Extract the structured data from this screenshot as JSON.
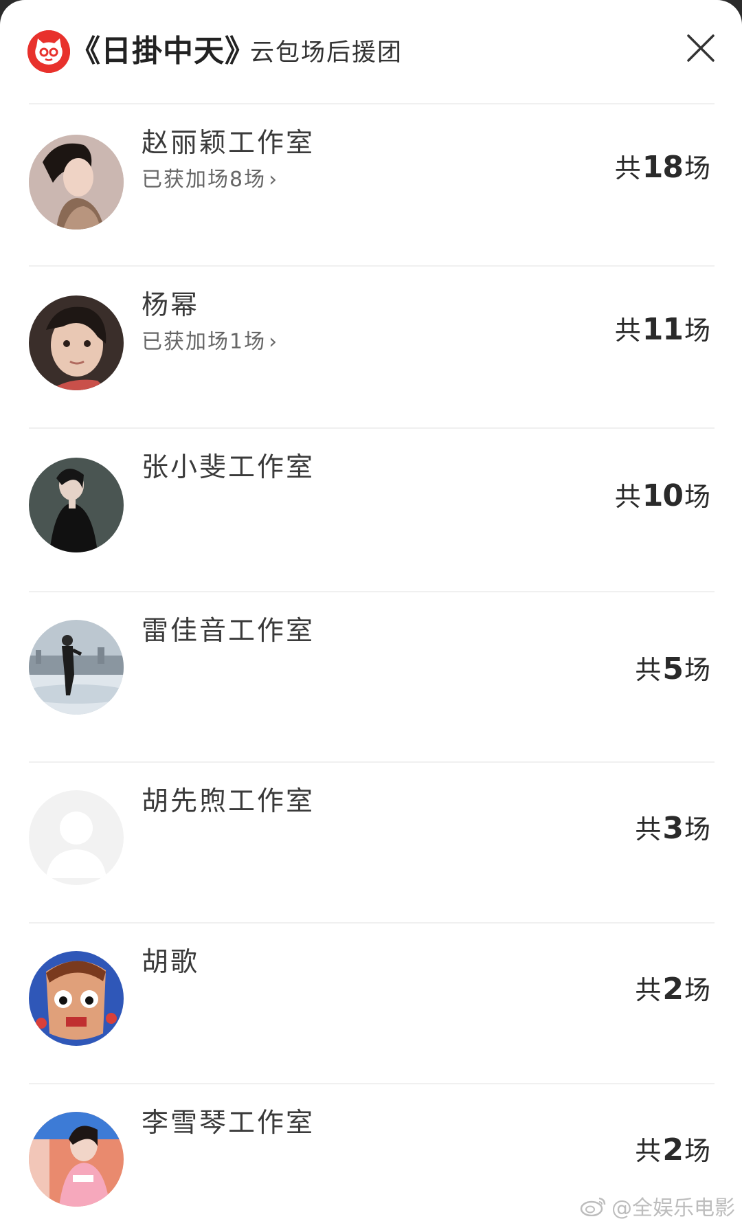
{
  "header": {
    "title": "《日掛中天》",
    "subtitle": "云包场后援团"
  },
  "rows": [
    {
      "name": "赵丽颖工作室",
      "bonus": "已获加场8场",
      "count_prefix": "共",
      "count_num": "18",
      "count_suffix": "场"
    },
    {
      "name": "杨幂",
      "bonus": "已获加场1场",
      "count_prefix": "共",
      "count_num": "11",
      "count_suffix": "场"
    },
    {
      "name": "张小斐工作室",
      "count_prefix": "共",
      "count_num": "10",
      "count_suffix": "场"
    },
    {
      "name": "雷佳音工作室",
      "count_prefix": "共",
      "count_num": "5",
      "count_suffix": "场"
    },
    {
      "name": "胡先煦工作室",
      "count_prefix": "共",
      "count_num": "3",
      "count_suffix": "场"
    },
    {
      "name": "胡歌",
      "count_prefix": "共",
      "count_num": "2",
      "count_suffix": "场"
    },
    {
      "name": "李雪琴工作室",
      "count_prefix": "共",
      "count_num": "2",
      "count_suffix": "场"
    }
  ],
  "watermark": {
    "text": "@全娱乐电影"
  },
  "colors": {
    "brand": "#e8312c",
    "divider": "#f0f0f0"
  }
}
